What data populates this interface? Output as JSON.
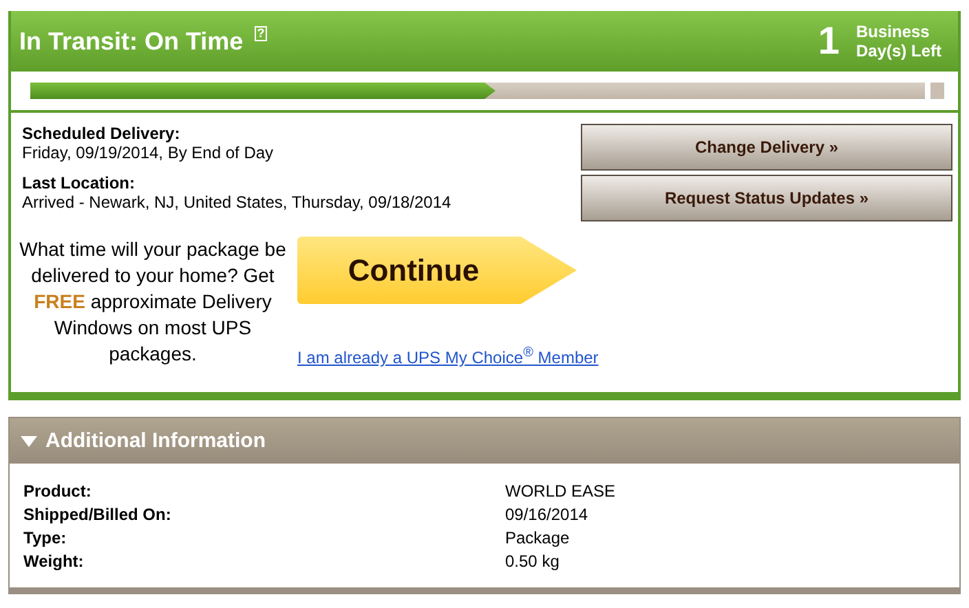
{
  "status": {
    "title": "In Transit: On Time",
    "help": "?",
    "days": "1",
    "days_label": "Business Day(s) Left"
  },
  "progress": {
    "level": 0.52
  },
  "details": [
    {
      "label": "Scheduled Delivery:",
      "value": "Friday, 09/19/2014, By End of Day"
    },
    {
      "label": "Last Location:",
      "value": "Arrived - Newark, NJ, United States, Thursday, 09/18/2014"
    }
  ],
  "buttons": [
    "Change Delivery »",
    "Request Status Updates »"
  ],
  "promo": {
    "text": "What time will your package be delivered to your home? Get **FREE** approximate Delivery Windows on most UPS packages.",
    "button": "Continue",
    "link": "I am already a UPS My Choice$^{®}$ Member"
  },
  "additional": {
    "title": "Additional Information",
    "expanded": true,
    "rows": [
      {
        "label": "Product:",
        "value": "WORLD EASE"
      },
      {
        "label": "Shipped/Billed On:",
        "value": "09/16/2014"
      },
      {
        "label": "Type:",
        "value": "Package"
      },
      {
        "label": "Weight:",
        "value": "0.50 kg"
      }
    ]
  }
}
